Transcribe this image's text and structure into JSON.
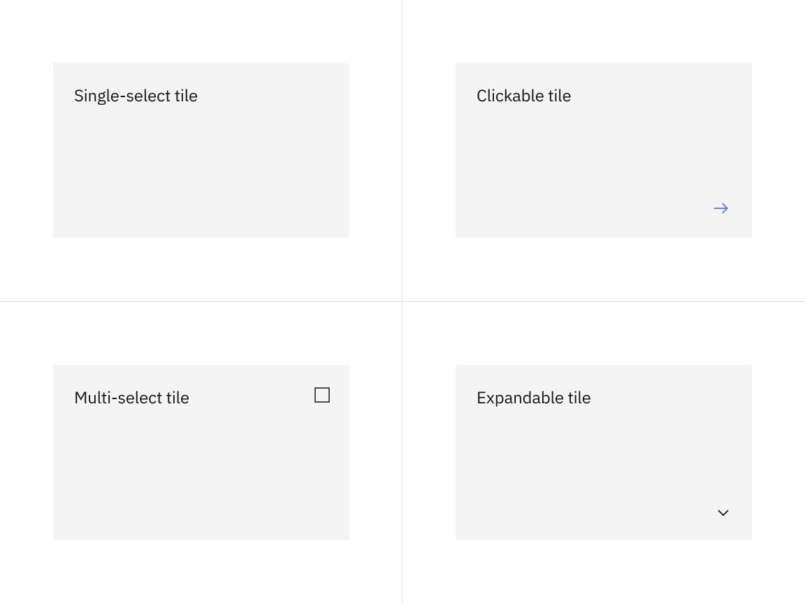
{
  "tiles": {
    "single_select": {
      "label": "Single-select tile"
    },
    "clickable": {
      "label": "Clickable tile"
    },
    "multi_select": {
      "label": "Multi-select tile"
    },
    "expandable": {
      "label": "Expandable tile"
    }
  },
  "colors": {
    "tile_bg": "#f4f4f4",
    "border": "#e0e0e0",
    "text": "#161616",
    "link": "#4876ff"
  }
}
